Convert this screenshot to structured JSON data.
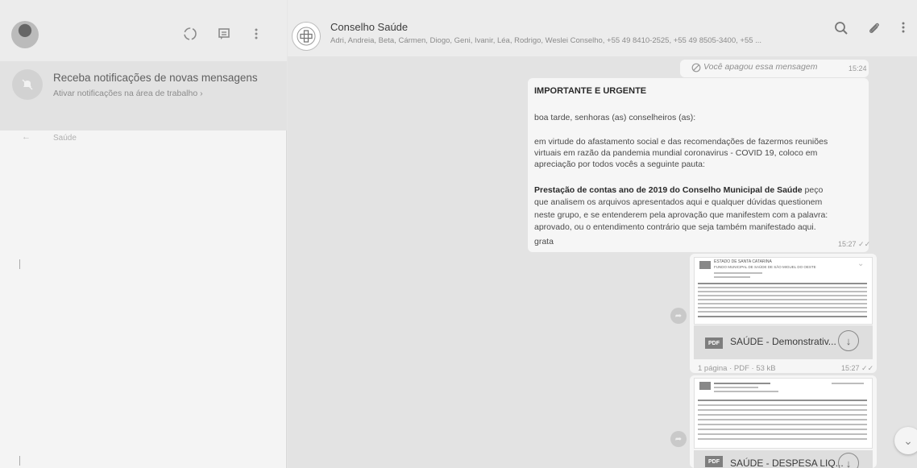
{
  "sidebar": {
    "notification": {
      "title": "Receba notificações de novas mensagens",
      "subtitle": "Ativar notificações na área de trabalho ›"
    },
    "search": {
      "placeholder": "Saúde"
    }
  },
  "chat": {
    "name": "Conselho  Saúde",
    "members": "Adri, Andreia, Beta, Cármen, Diogo, Geni, Ivanir, Léa, Rodrigo, Weslei Conselho, +55 49 8410-2525, +55 49 8505-3400, +55 ...",
    "deleted_message": {
      "text": "Você apagou essa mensagem",
      "time": "15:24"
    },
    "message": {
      "title": "IMPORTANTE E URGENTE",
      "lines": [
        "boa tarde, senhoras (as) conselheiros (as):",
        "em virtude do afastamento social e das recomendações de fazermos reuniões",
        "virtuais em razão da pandemia mundial coronavirus - COVID 19,  coloco em",
        "apreciação por todos vocês a seguinte pauta:",
        "que analisem os arquivos apresentados aqui e qualquer dúvidas questionem",
        "neste grupo, e se entenderem pela aprovação que manifestem com a palavra:",
        "aprovado, ou o entendimento contrário que seja também manifestado aqui.",
        "grata"
      ],
      "bold_line": "Prestação de contas ano de 2019 do Conselho Municipal de Saúde",
      "bold_suffix": " peço",
      "time": "15:27"
    },
    "attachments": [
      {
        "name": "SAÚDE - Demonstrativ...",
        "meta": "1 página · PDF · 53 kB",
        "time": "15:27",
        "thumb_header": "ESTADO DE SANTA CATARINA",
        "thumb_sub": "FUNDO MUNICIPAL DE SAÚDE DE SÃO MIGUEL DO OESTE"
      },
      {
        "name": "SAÚDE - DESPESA LIQ..."
      }
    ],
    "pdf_label": "PDF"
  },
  "icons": {
    "status": "status-icon",
    "new_chat": "new-chat-icon",
    "menu": "menu-icon",
    "search": "search-icon",
    "attach": "paperclip-icon",
    "download": "download-icon",
    "forward": "forward-icon",
    "scroll_down": "chevron-down-icon"
  }
}
